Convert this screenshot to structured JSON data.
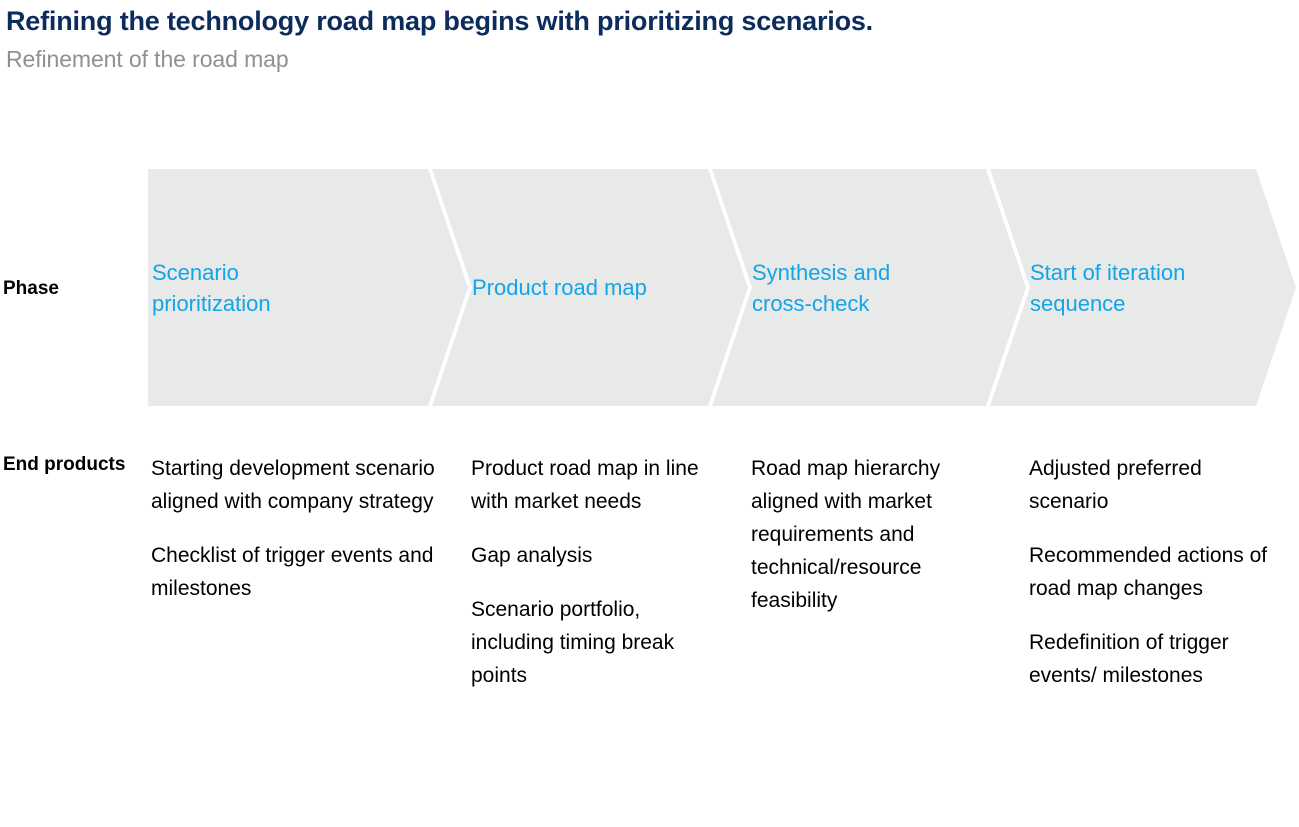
{
  "header": {
    "title": "Refining the technology road map begins with prioritizing scenarios.",
    "subtitle": "Refinement of the road map",
    "title_color": "#0d2c5e",
    "subtitle_color": "#8f9091"
  },
  "colors": {
    "accent_cyan": "#12a5e8",
    "chevron_fill": "#e8e9e9",
    "chevron_divider": "#ffffff",
    "text_black": "#000000"
  },
  "rows": {
    "phase_label": "Phase",
    "end_products_label": "End products"
  },
  "phases": [
    {
      "label_line1": "Scenario",
      "label_line2": "prioritization"
    },
    {
      "label_line1": "Product road map",
      "label_line2": ""
    },
    {
      "label_line1": "Synthesis and",
      "label_line2": "cross-check"
    },
    {
      "label_line1": "Start of iteration",
      "label_line2": "sequence"
    }
  ],
  "end_products": [
    {
      "items": [
        "Starting development scenario aligned with company strategy",
        "Checklist of trigger events and milestones"
      ]
    },
    {
      "items": [
        "Product road map in line with market needs",
        "Gap analysis",
        "Scenario portfolio, including timing break points"
      ]
    },
    {
      "items": [
        "Road map hierarchy aligned with market requirements and technical/resource feasibility"
      ]
    },
    {
      "items": [
        "Adjusted preferred scenario",
        "Recommended actions of road map changes",
        "Redefinition of trigger events/ milestones"
      ]
    }
  ]
}
